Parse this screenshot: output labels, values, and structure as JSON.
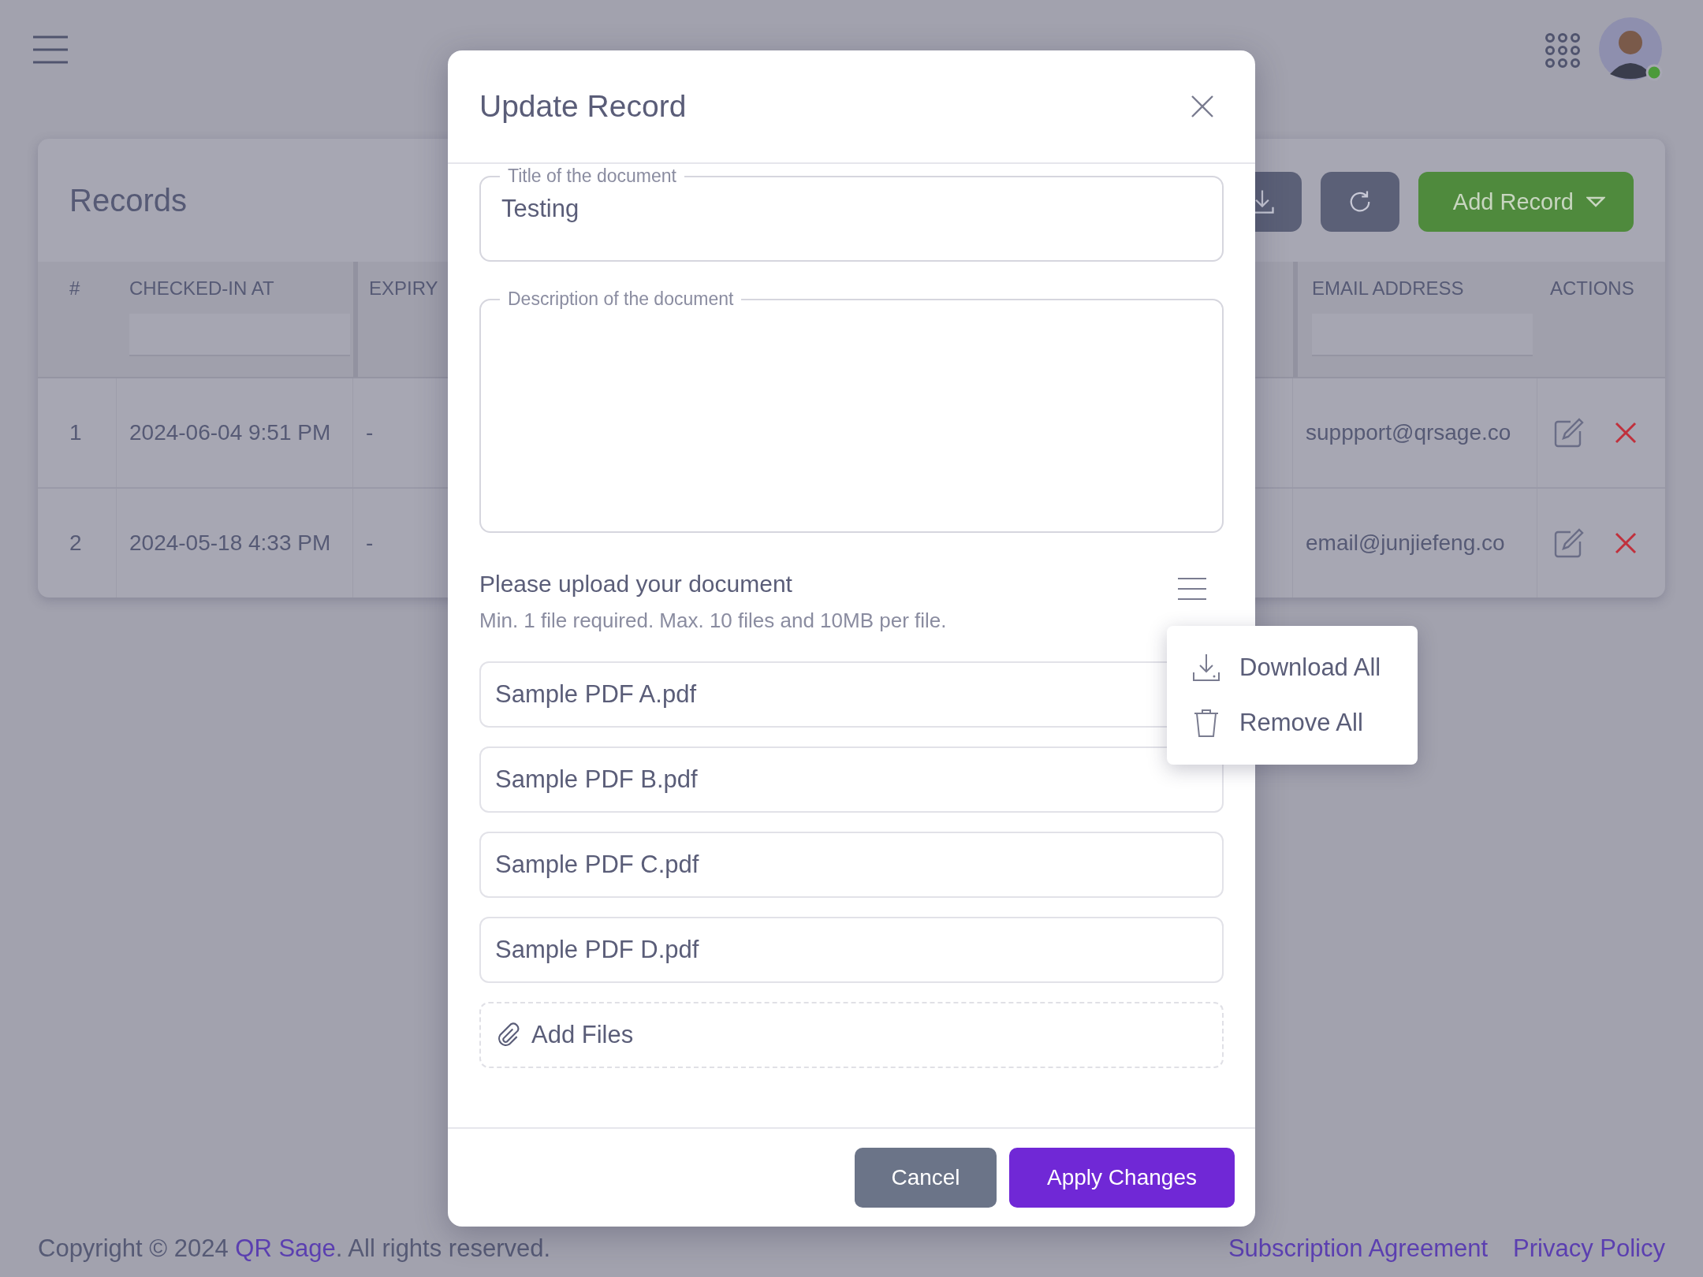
{
  "records": {
    "title": "Records",
    "add_button": "Add Record",
    "columns": [
      {
        "label": "#"
      },
      {
        "label": "CHECKED-IN AT"
      },
      {
        "label": "EXPIRY"
      },
      {
        "label": "EMAIL ADDRESS"
      },
      {
        "label": "ACTIONS"
      }
    ],
    "rows": [
      {
        "index": "1",
        "checked_in": "2024-06-04 9:51 PM",
        "expiry": "-",
        "email": "suppport@qrsage.co"
      },
      {
        "index": "2",
        "checked_in": "2024-05-18 4:33 PM",
        "expiry": "-",
        "email": "email@junjiefeng.co"
      }
    ]
  },
  "modal": {
    "title": "Update Record",
    "title_field": {
      "label": "Title of the document",
      "value": "Testing"
    },
    "description_field": {
      "label": "Description of the document"
    },
    "upload": {
      "heading": "Please upload your document",
      "hint": "Min. 1 file required. Max. 10 files and 10MB per file.",
      "files": [
        "Sample PDF A.pdf",
        "Sample PDF B.pdf",
        "Sample PDF C.pdf",
        "Sample PDF D.pdf"
      ],
      "add_files": "Add Files"
    },
    "menu": [
      {
        "kind": "download",
        "label": "Download All"
      },
      {
        "kind": "remove",
        "label": "Remove All"
      }
    ],
    "buttons": {
      "cancel": "Cancel",
      "apply": "Apply Changes"
    }
  },
  "footer": {
    "copyright_before": "Copyright © 2024 ",
    "brand_link": "QR Sage",
    "copyright_after": ". All rights reserved.",
    "links": [
      "Subscription Agreement",
      "Privacy Policy"
    ]
  }
}
